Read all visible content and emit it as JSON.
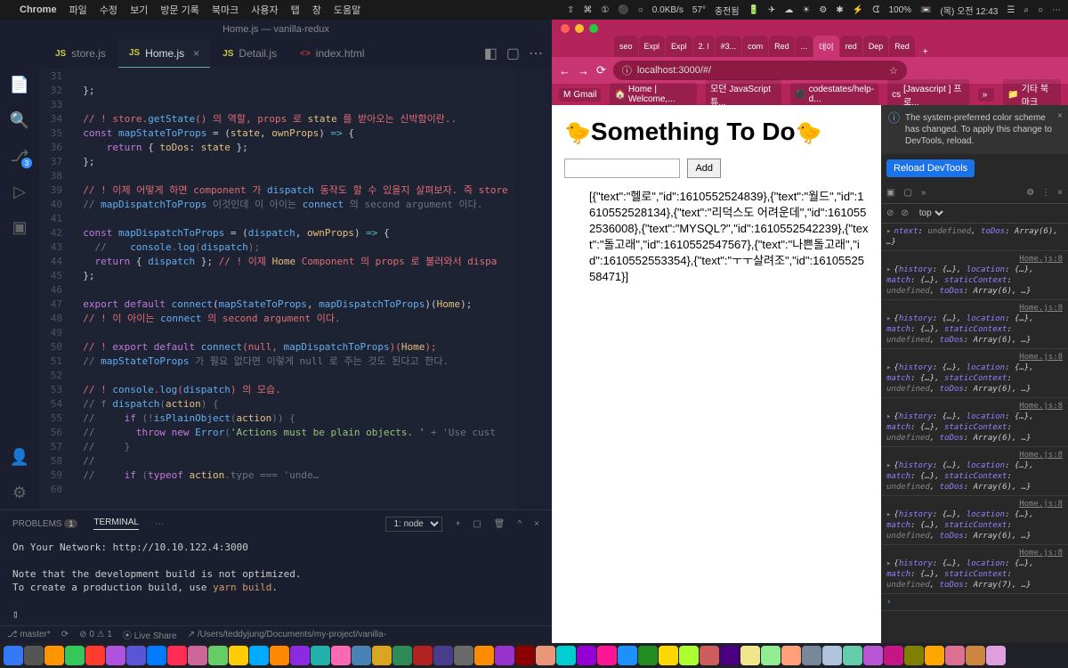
{
  "menubar": {
    "app": "Chrome",
    "items": [
      "파일",
      "수정",
      "보기",
      "방문 기록",
      "북마크",
      "사용자",
      "탭",
      "창",
      "도움말"
    ],
    "right": [
      "⇧",
      "⌘",
      "①",
      "⚫",
      "○",
      "0.0KB/s",
      "57°",
      "충전됨",
      "🔋",
      "✈",
      "☁",
      "☀",
      "⚙",
      "✱",
      "⚡",
      "ᗧ",
      "100%",
      "📼",
      "(목) 오전 12:43",
      "☰",
      "⌕",
      "○",
      "⋯"
    ]
  },
  "vscode": {
    "title": "Home.js — vanilla-redux",
    "tabs": [
      {
        "icon": "JS",
        "name": "store.js",
        "active": false
      },
      {
        "icon": "JS",
        "name": "Home.js",
        "active": true,
        "close": "×"
      },
      {
        "icon": "JS",
        "name": "Detail.js",
        "active": false
      },
      {
        "icon": "<>",
        "name": "index.html",
        "active": false
      }
    ],
    "lines": {
      "start": 31,
      "count": 30
    },
    "code_lines": [
      "",
      "  };",
      "",
      "  // ! store.getState() 의 역할, props 로 state 를 받아오는 신박함이란..",
      "  const mapStateToProps = (state, ownProps) => {",
      "      return { toDos: state };",
      "  };",
      "",
      "  // ! 이제 어떻게 하면 component 가 dispatch 동작도 할 수 있을지 살펴보자. 즉 store",
      "  // mapDispatchToProps 이것인데 이 아이는 connect 의 second argument 이다.",
      "",
      "  const mapDispatchToProps = (dispatch, ownProps) => {",
      "    //    console.log(dispatch);",
      "    return { dispatch }; // ! 이제 Home Component 의 props 로 불러와서 dispa",
      "  };",
      "",
      "  export default connect(mapStateToProps, mapDispatchToProps)(Home);",
      "  // ! 이 아이는 connect 의 second argument 이다.",
      "",
      "  // ! export default connect(null, mapDispatchToProps)(Home);",
      "  // mapStateToProps 가 필요 없다면 이렇게 null 로 주는 것도 된다고 한다.",
      "",
      "  // ! console.log(dispatch) 의 모습.",
      "  // f dispatch(action) {",
      "  //     if (!isPlainObject(action)) {",
      "  //       throw new Error('Actions must be plain objects. ' + 'Use cust",
      "  //     }",
      "  //",
      "  //     if (typeof action.type === 'unde…",
      ""
    ],
    "terminal": {
      "tabs": {
        "problems": "PROBLEMS",
        "problems_badge": "1",
        "terminal": "TERMINAL",
        "dots": "⋯"
      },
      "selector": "1: node",
      "icons": {
        "plus": "+",
        "split": "▢",
        "trash": "🗑",
        "up": "^",
        "close": "×"
      },
      "body": [
        "  On Your Network:  http://10.10.122.4:3000",
        "",
        "Note that the development build is not optimized.",
        "To create a production build, use yarn build.",
        "",
        "▯"
      ]
    },
    "status": {
      "branch": "⎇ master*",
      "sync": "⟳",
      "errors": "⊘ 0 ⚠ 1",
      "live": "⦿ Live Share",
      "path": "↗  /Users/teddyjung/Documents/my-project/vanilla-"
    }
  },
  "chrome": {
    "tabs": [
      {
        "label": "seo"
      },
      {
        "label": "Expl"
      },
      {
        "label": "Expl"
      },
      {
        "label": "2. l"
      },
      {
        "label": "#3..."
      },
      {
        "label": "com"
      },
      {
        "label": "Red"
      },
      {
        "label": "..."
      },
      {
        "label": "데이",
        "active": true
      },
      {
        "label": "red"
      },
      {
        "label": "Dep"
      },
      {
        "label": "Red"
      }
    ],
    "plus": "+",
    "nav": {
      "back": "←",
      "fwd": "→",
      "reload": "⟳"
    },
    "url_icon": "ⓘ",
    "url": "localhost:3000/#/",
    "star": "☆",
    "bookmarks": [
      {
        "icon": "M",
        "label": "Gmail"
      },
      {
        "icon": "🏠",
        "label": "Home | Welcome,..."
      },
      {
        "icon": "",
        "label": "모던 JavaScript 튜..."
      },
      {
        "icon": "⚫",
        "label": "codestates/help-d..."
      },
      {
        "icon": "cs",
        "label": "[Javascript ] 프로..."
      },
      {
        "icon": "»",
        "label": ""
      },
      {
        "icon": "📁",
        "label": "기타 북마크",
        "right": true
      }
    ],
    "page": {
      "title_emoji": "🐤",
      "title": "Something To Do",
      "input_value": "",
      "button": "Add",
      "json_text": "[{\"text\":\"헬로\",\"id\":1610552524839},{\"text\":\"월드\",\"id\":1610552528134},{\"text\":\"리덕스도 어려운데\",\"id\":1610552536008},{\"text\":\"MYSQL?\",\"id\":1610552542239},{\"text\":\"돌고래\",\"id\":1610552547567},{\"text\":\"나쁜돌고래\",\"id\":1610552553354},{\"text\":\"ㅜㅜ살려조\",\"id\":1610552558471}]"
    },
    "devtools": {
      "info_icon": "ⓘ",
      "info": "The system-preferred color scheme has changed. To apply this change to DevTools, reload.",
      "close": "×",
      "reload": "Reload DevTools",
      "toolbar": {
        "inspect": "▣",
        "device": "▢",
        "more": "»",
        "gear": "⚙",
        "dots": "⋮",
        "x": "×"
      },
      "filter": {
        "eye": "⊘",
        "ban": "⊘",
        "scope": "top",
        "arrow": "▾"
      },
      "messages": [
        {
          "src": "",
          "body": "ntext: undefined, toDos: Array(6), …}"
        },
        {
          "src": "Home.js:8",
          "body": "{history: {…}, location: {…}, match: {…}, staticContext: undefined, toDos: Array(6), …}"
        },
        {
          "src": "Home.js:8",
          "body": "{history: {…}, location: {…}, match: {…}, staticContext: undefined, toDos: Array(6), …}"
        },
        {
          "src": "Home.js:8",
          "body": "{history: {…}, location: {…}, match: {…}, staticContext: undefined, toDos: Array(6), …}"
        },
        {
          "src": "Home.js:8",
          "body": "{history: {…}, location: {…}, match: {…}, staticContext: undefined, toDos: Array(6), …}"
        },
        {
          "src": "Home.js:8",
          "body": "{history: {…}, location: {…}, match: {…}, staticContext: undefined, toDos: Array(6), …}"
        },
        {
          "src": "Home.js:8",
          "body": "{history: {…}, location: {…}, match: {…}, staticContext: undefined, toDos: Array(6), …}"
        },
        {
          "src": "Home.js:8",
          "body": "{history: {…}, location: {…}, match: {…}, staticContext: undefined, toDos: Array(7), …}"
        }
      ],
      "prompt": "›"
    }
  }
}
